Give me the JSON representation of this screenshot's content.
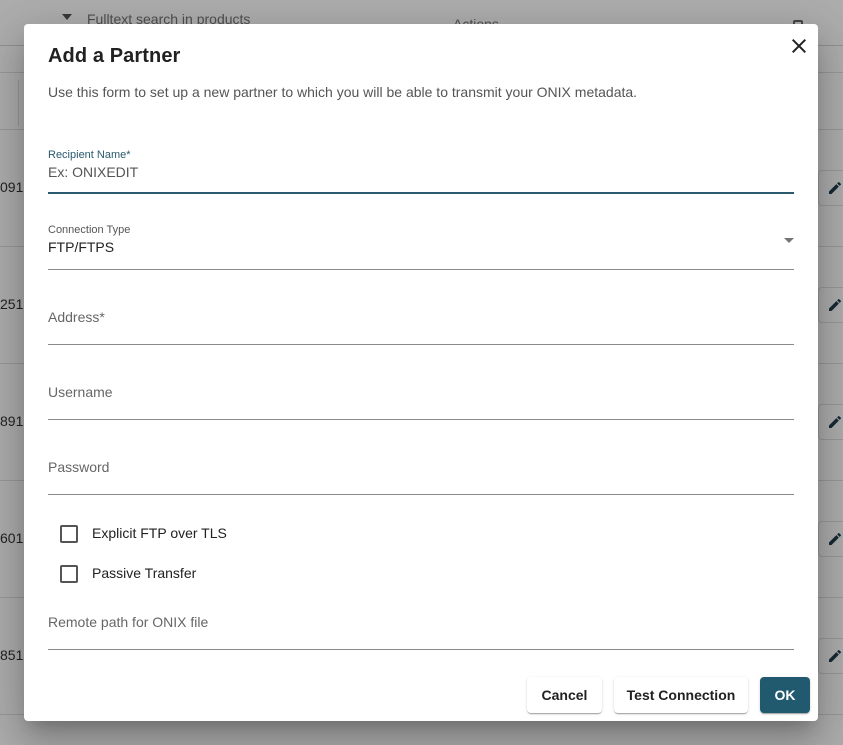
{
  "background": {
    "search_placeholder": "Fulltext search in products",
    "actions_header": "Actions",
    "row_numbers": [
      "091",
      "251",
      "891",
      "601",
      "851"
    ],
    "row_edit_icon": "pencil-icon"
  },
  "dialog": {
    "title": "Add a Partner",
    "description": "Use this form to set up a new partner to which you will be able to transmit your ONIX metadata.",
    "close_icon": "close-icon",
    "recipient_name": {
      "label": "Recipient Name*",
      "placeholder": "Ex: ONIXEDIT",
      "value": ""
    },
    "connection_type": {
      "label": "Connection Type",
      "value": "FTP/FTPS"
    },
    "address": {
      "label": "Address*",
      "value": ""
    },
    "username": {
      "label": "Username",
      "value": ""
    },
    "password": {
      "label": "Password",
      "value": ""
    },
    "explicit_ftp_tls": {
      "label": "Explicit FTP over TLS",
      "checked": false
    },
    "passive_transfer": {
      "label": "Passive Transfer",
      "checked": false
    },
    "remote_path": {
      "label": "Remote path for ONIX file",
      "value": ""
    },
    "buttons": {
      "cancel": "Cancel",
      "test_connection": "Test Connection",
      "ok": "OK"
    }
  },
  "colors": {
    "primary": "#215a6e",
    "focus": "#2a5a6e",
    "scrim": "rgba(0,0,0,0.32)"
  }
}
